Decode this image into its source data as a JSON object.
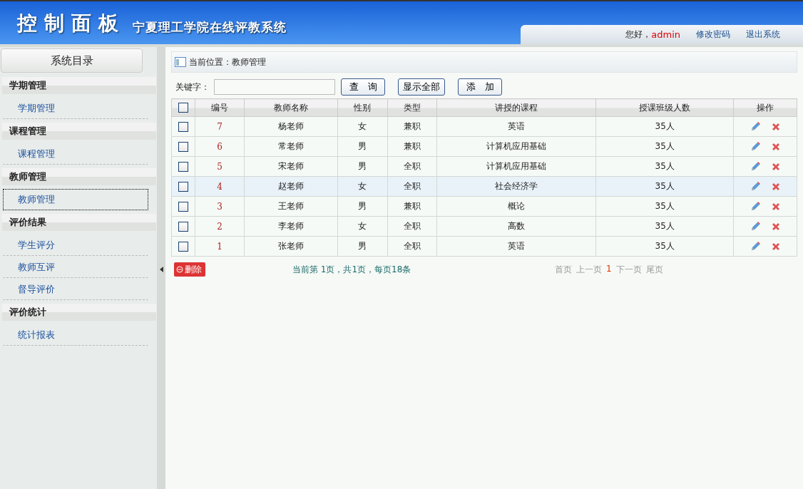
{
  "header": {
    "title": "控制面板",
    "subtitle": "宁夏理工学院在线评教系统",
    "greeting": "您好，",
    "user": "admin",
    "links": [
      "修改密码",
      "退出系统"
    ]
  },
  "sidebar": {
    "title": "系统目录",
    "groups": [
      {
        "label": "学期管理",
        "items": [
          {
            "label": "学期管理",
            "selected": false
          }
        ]
      },
      {
        "label": "课程管理",
        "items": [
          {
            "label": "课程管理",
            "selected": false
          }
        ]
      },
      {
        "label": "教师管理",
        "items": [
          {
            "label": "教师管理",
            "selected": true
          }
        ]
      },
      {
        "label": "评价结果",
        "items": [
          {
            "label": "学生评分",
            "selected": false
          },
          {
            "label": "教师互评",
            "selected": false
          },
          {
            "label": "督导评价",
            "selected": false
          }
        ]
      },
      {
        "label": "评价统计",
        "items": [
          {
            "label": "统计报表",
            "selected": false
          }
        ]
      }
    ]
  },
  "breadcrumb": "当前位置：教师管理",
  "search": {
    "label": "关键字：",
    "buttons": [
      "查　询",
      "显示全部",
      "添　加"
    ]
  },
  "table": {
    "select_all": {
      "checked": false
    },
    "columns": [
      "编号",
      "教师名称",
      "性别",
      "类型",
      "讲授的课程",
      "授课班级人数",
      "操作"
    ],
    "rows": [
      {
        "cells": [
          "7",
          "杨老师",
          "女",
          "兼职",
          "英语",
          "35人"
        ],
        "checked": false,
        "highlighted": false
      },
      {
        "cells": [
          "6",
          "常老师",
          "男",
          "兼职",
          "计算机应用基础",
          "35人"
        ],
        "checked": false,
        "highlighted": false
      },
      {
        "cells": [
          "5",
          "宋老师",
          "男",
          "全职",
          "计算机应用基础",
          "35人"
        ],
        "checked": false,
        "highlighted": false
      },
      {
        "cells": [
          "4",
          "赵老师",
          "女",
          "全职",
          "社会经济学",
          "35人"
        ],
        "checked": false,
        "highlighted": true
      },
      {
        "cells": [
          "3",
          "王老师",
          "男",
          "兼职",
          "概论",
          "35人"
        ],
        "checked": false,
        "highlighted": false
      },
      {
        "cells": [
          "2",
          "李老师",
          "女",
          "全职",
          "高数",
          "35人"
        ],
        "checked": false,
        "highlighted": false
      },
      {
        "cells": [
          "1",
          "张老师",
          "男",
          "全职",
          "英语",
          "35人"
        ],
        "checked": false,
        "highlighted": false
      }
    ]
  },
  "delete_button": "删除",
  "page_info": "当前第 1页，共1页，每页18条",
  "pager": [
    {
      "label": "首页",
      "selected": false
    },
    {
      "label": "上一页",
      "selected": false
    },
    {
      "label": "1",
      "selected": true
    },
    {
      "label": "下一页",
      "selected": false
    },
    {
      "label": "尾页",
      "selected": false
    }
  ]
}
